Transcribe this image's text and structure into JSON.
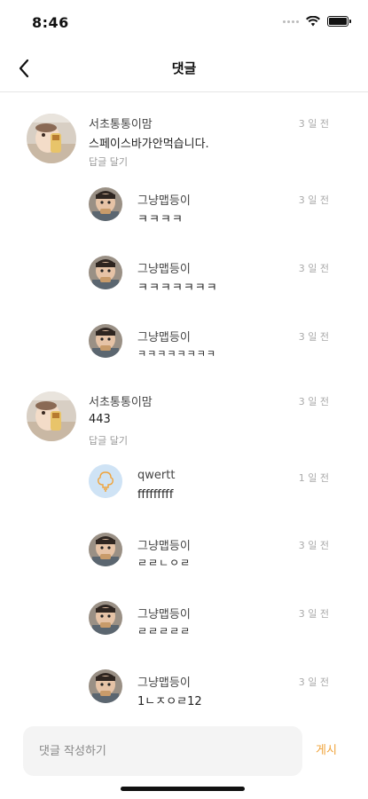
{
  "status": {
    "time": "8:46"
  },
  "nav": {
    "title": "댓글"
  },
  "comments": [
    {
      "name": "서초통통이맘",
      "time": "3 일 전",
      "text": "스페이스바가안먹습니다.",
      "reply_label": "답글 달기",
      "avatar": "baby-photo"
    },
    {
      "name": "그냥맵등이",
      "time": "3 일 전",
      "text": "ㅋㅋㅋㅋ",
      "avatar": "kid-photo"
    },
    {
      "name": "그냥맵등이",
      "time": "3 일 전",
      "text": "ㅋㅋㅋㅋㅋㅋㅋ",
      "avatar": "kid-photo"
    },
    {
      "name": "그냥맵등이",
      "time": "3 일 전",
      "text": "ㅋㅋㅋㅋㅋㅋㅋㅋ",
      "avatar": "kid-photo"
    },
    {
      "name": "서초통통이맘",
      "time": "3 일 전",
      "text": "443",
      "reply_label": "답글 달기",
      "avatar": "baby-photo"
    },
    {
      "name": "qwertt",
      "time": "1 일 전",
      "text": "fffffffff",
      "avatar": "default-profile-icon"
    },
    {
      "name": "그냥맵등이",
      "time": "3 일 전",
      "text": "ㄹㄹㄴㅇㄹ",
      "avatar": "kid-photo"
    },
    {
      "name": "그냥맵등이",
      "time": "3 일 전",
      "text": "ㄹㄹㄹㄹㄹ",
      "avatar": "kid-photo"
    },
    {
      "name": "그냥맵등이",
      "time": "3 일 전",
      "text": "1ㄴㅈㅇㄹ12",
      "avatar": "kid-photo"
    }
  ],
  "input": {
    "placeholder": "댓글 작성하기",
    "post_label": "게시"
  },
  "colors": {
    "accent": "#f0a33a",
    "divider": "#e6e6e6",
    "input_bg": "#f4f4f4"
  }
}
